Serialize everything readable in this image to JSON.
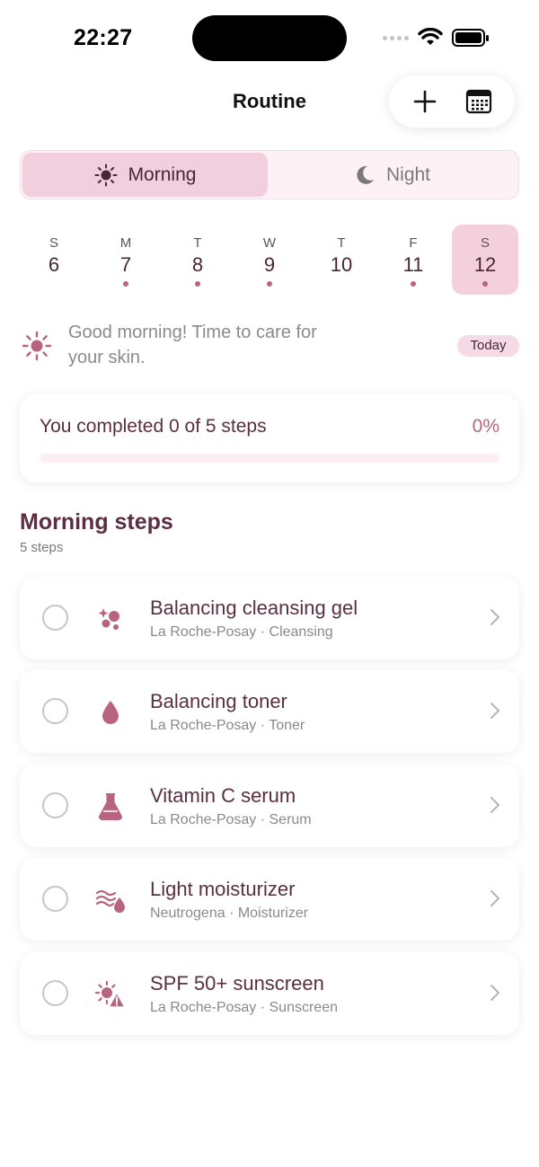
{
  "status_bar": {
    "time": "22:27"
  },
  "header": {
    "title": "Routine",
    "add_icon": "plus-icon",
    "calendar_icon": "calendar-icon"
  },
  "segmented": {
    "morning_label": "Morning",
    "night_label": "Night",
    "selected": "Morning"
  },
  "week": {
    "days": [
      {
        "letter": "S",
        "number": "6",
        "has_dot": false,
        "selected": false
      },
      {
        "letter": "M",
        "number": "7",
        "has_dot": true,
        "selected": false
      },
      {
        "letter": "T",
        "number": "8",
        "has_dot": true,
        "selected": false
      },
      {
        "letter": "W",
        "number": "9",
        "has_dot": true,
        "selected": false
      },
      {
        "letter": "T",
        "number": "10",
        "has_dot": false,
        "selected": false
      },
      {
        "letter": "F",
        "number": "11",
        "has_dot": true,
        "selected": false
      },
      {
        "letter": "S",
        "number": "12",
        "has_dot": true,
        "selected": true
      }
    ]
  },
  "greeting": {
    "line1": "Good morning! Time to care for",
    "line2": "your skin.",
    "badge": "Today"
  },
  "progress": {
    "text": "You completed 0 of 5 steps",
    "percent_label": "0%",
    "fraction": 0
  },
  "section": {
    "title": "Morning steps",
    "subtitle": "5 steps"
  },
  "steps": [
    {
      "name": "Balancing cleansing gel",
      "meta": "La Roche-Posay · Cleansing",
      "icon": "sparkles-bubbles-icon",
      "done": false
    },
    {
      "name": "Balancing toner",
      "meta": "La Roche-Posay · Toner",
      "icon": "drop-icon",
      "done": false
    },
    {
      "name": "Vitamin C serum",
      "meta": "La Roche-Posay · Serum",
      "icon": "flask-icon",
      "done": false
    },
    {
      "name": "Light moisturizer",
      "meta": "Neutrogena · Moisturizer",
      "icon": "moisture-waves-icon",
      "done": false
    },
    {
      "name": "SPF 50+ sunscreen",
      "meta": "La Roche-Posay · Sunscreen",
      "icon": "sun-warning-icon",
      "done": false
    }
  ],
  "colors": {
    "accent": "#b86481",
    "accent_light": "#f2cfdc",
    "title_text": "#5b2f40"
  }
}
